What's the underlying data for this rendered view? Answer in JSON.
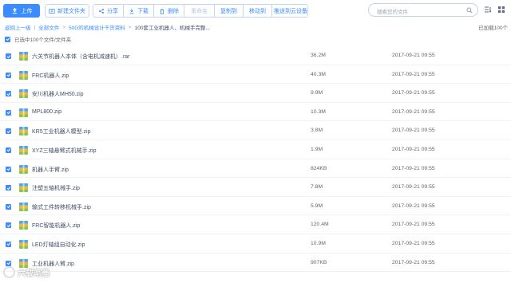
{
  "toolbar": {
    "upload_label": "上传",
    "new_folder_label": "新建文件夹",
    "share_label": "分享",
    "download_label": "下载",
    "delete_label": "删除",
    "rename_label": "重命名",
    "copy_to_label": "复制到",
    "move_to_label": "移动到",
    "push_label": "推送到云设备",
    "search_placeholder": "搜索您的文件"
  },
  "breadcrumb": {
    "back": "返回上一级",
    "all_files": "全部文件",
    "level1": "50G的机械设计干货资料",
    "level2": "100套工业机器人、机械手完整...",
    "loaded_text": "已加载100个"
  },
  "selection": {
    "text": "已选中100个文件/文件夹"
  },
  "files": [
    {
      "name": "六关节机器人本体（含电机减速机）.rar",
      "size": "36.2M",
      "time": "2017-09-21 09:55"
    },
    {
      "name": "FRC机器人.zip",
      "size": "40.3M",
      "time": "2017-09-21 09:55"
    },
    {
      "name": "安川机器人MH50.zip",
      "size": "9.9M",
      "time": "2017-09-21 09:55"
    },
    {
      "name": "MPL800.zip",
      "size": "10.3M",
      "time": "2017-09-21 09:55"
    },
    {
      "name": "KR5工业机器人模型.zip",
      "size": "3.8M",
      "time": "2017-09-21 09:55"
    },
    {
      "name": "XYZ三轴悬臂式机械手.zip",
      "size": "1.9M",
      "time": "2017-09-21 09:55"
    },
    {
      "name": "机器人手臂.zip",
      "size": "824KB",
      "time": "2017-09-21 09:55"
    },
    {
      "name": "注塑五轴机械手.zip",
      "size": "7.8M",
      "time": "2017-09-21 09:55"
    },
    {
      "name": "输式工件转移机械手.zip",
      "size": "5.9M",
      "time": "2017-09-21 09:55"
    },
    {
      "name": "FRC智能机器人.zip",
      "size": "120.4M",
      "time": "2017-09-21 09:55"
    },
    {
      "name": "LED灯轴组自动化.zip",
      "size": "10.9M",
      "time": "2017-09-21 09:55"
    },
    {
      "name": "工业机器人臂.zip",
      "size": "907KB",
      "time": "2017-09-21 09:55"
    }
  ],
  "watermark": {
    "text": "六载笔墨"
  },
  "colors": {
    "accent": "#3b8cff",
    "text": "#424e67",
    "muted": "#666666"
  }
}
